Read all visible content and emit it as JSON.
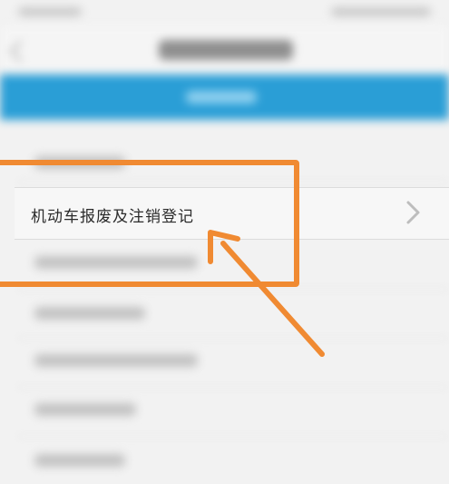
{
  "item": {
    "label": "机动车报废及注销登记"
  },
  "colors": {
    "accent_banner": "#2a9ed6",
    "annotation": "#f08a32"
  },
  "icons": {
    "row_chevron": "chevron-right-icon",
    "header_back": "back-chevron-icon",
    "annotation_arrow": "arrow-pointer-icon"
  }
}
